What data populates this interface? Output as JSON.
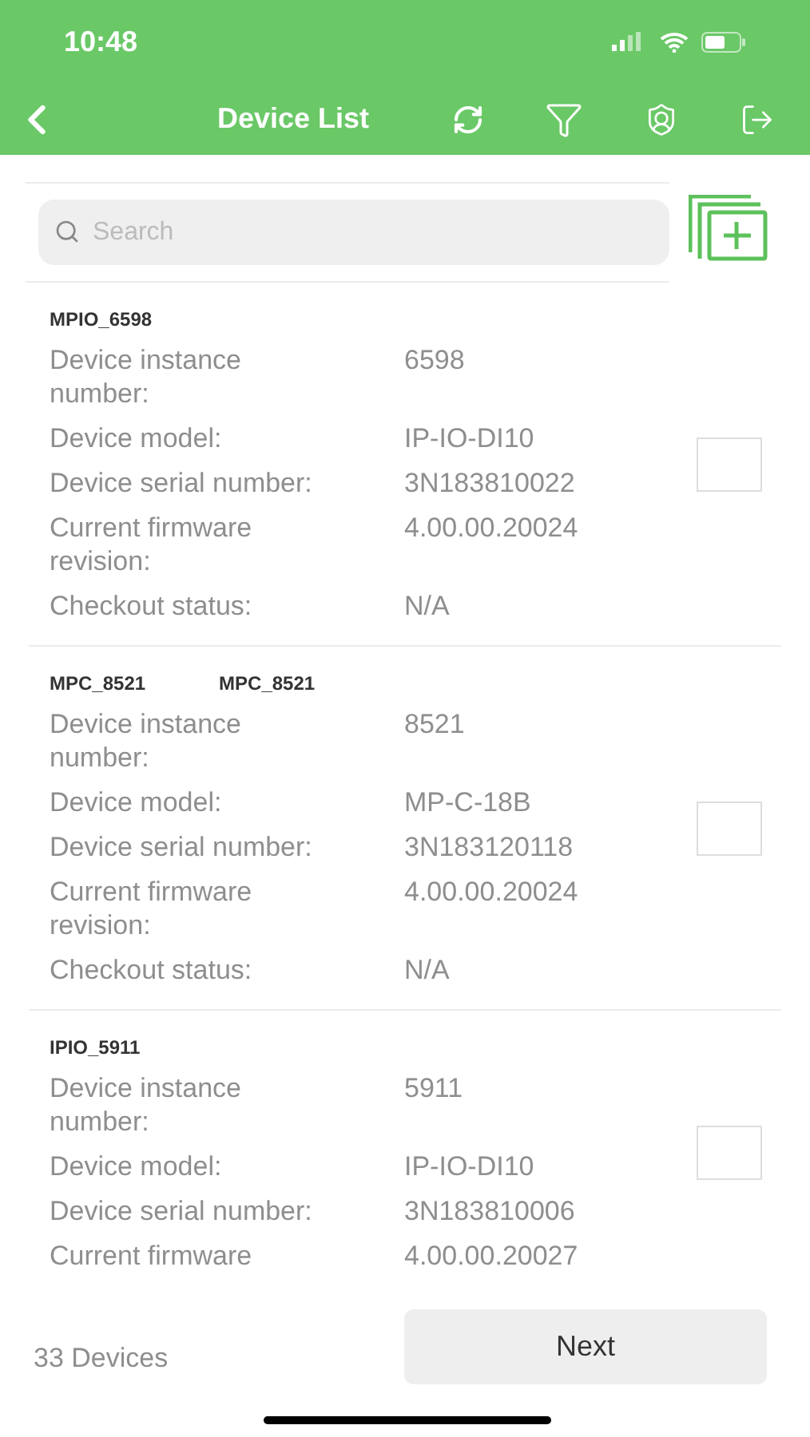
{
  "status_bar": {
    "time": "10:48"
  },
  "nav": {
    "title": "Device List"
  },
  "search": {
    "placeholder": "Search"
  },
  "devices": [
    {
      "names": [
        "MPIO_6598"
      ],
      "checked": false,
      "fields": [
        {
          "label": "Device instance number:",
          "value": "6598"
        },
        {
          "label": "Device model:",
          "value": "IP-IO-DI10"
        },
        {
          "label": "Device serial number:",
          "value": "3N183810022"
        },
        {
          "label": "Current firmware revision:",
          "value": "4.00.00.20024"
        },
        {
          "label": "Checkout status:",
          "value": "N/A"
        }
      ]
    },
    {
      "names": [
        "MPC_8521",
        "MPC_8521"
      ],
      "checked": false,
      "fields": [
        {
          "label": "Device instance number:",
          "value": "8521"
        },
        {
          "label": "Device model:",
          "value": "MP-C-18B"
        },
        {
          "label": "Device serial number:",
          "value": "3N183120118"
        },
        {
          "label": "Current firmware revision:",
          "value": "4.00.00.20024"
        },
        {
          "label": "Checkout status:",
          "value": "N/A"
        }
      ]
    },
    {
      "names": [
        "IPIO_5911"
      ],
      "checked": false,
      "fields": [
        {
          "label": "Device instance number:",
          "value": "5911"
        },
        {
          "label": "Device model:",
          "value": "IP-IO-DI10"
        },
        {
          "label": "Device serial number:",
          "value": "3N183810006"
        },
        {
          "label": "Current firmware",
          "value": "4.00.00.20027"
        }
      ]
    }
  ],
  "footer": {
    "count": "33 Devices",
    "next_button": "Next"
  }
}
